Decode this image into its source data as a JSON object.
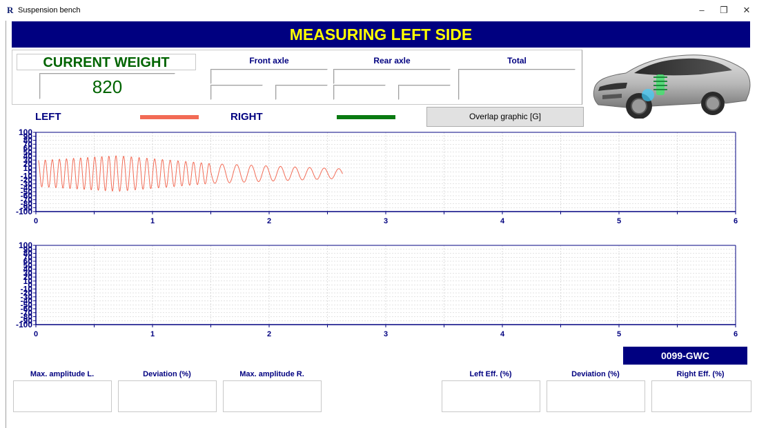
{
  "window": {
    "app_icon": "R",
    "title": "Suspension bench",
    "minimize": "–",
    "restore": "❐",
    "close": "✕"
  },
  "banner": {
    "title": "MEASURING LEFT SIDE"
  },
  "weight": {
    "label": "CURRENT WEIGHT",
    "value": "820",
    "front_axle": "Front axle",
    "rear_axle": "Rear axle",
    "total": "Total"
  },
  "legend": {
    "left_label": "LEFT",
    "right_label": "RIGHT",
    "left_color": "#f26b55",
    "right_color": "#0a7a12",
    "overlap_button": "Overlap graphic [G]"
  },
  "chart_data": [
    {
      "type": "line",
      "x_ticks": [
        "0",
        "1",
        "2",
        "3",
        "4",
        "5",
        "6"
      ],
      "y_ticks": [
        "100",
        "90",
        "80",
        "70",
        "60",
        "50",
        "40",
        "30",
        "20",
        "10",
        "0",
        "-10",
        "-20",
        "-30",
        "-40",
        "-50",
        "-60",
        "-70",
        "-80",
        "-90",
        "-100"
      ],
      "xlim": [
        0,
        6
      ],
      "ylim": [
        -100,
        100
      ],
      "grid": true,
      "series": [
        {
          "color": "#f26b55",
          "x_end": 2.63,
          "oscillation": [
            {
              "x_start": 0.02,
              "x_end": 0.7,
              "freq": 16.5,
              "amp_start": 33,
              "amp_end": 45
            },
            {
              "x_start": 0.7,
              "x_end": 1.5,
              "freq": 15.0,
              "amp_start": 45,
              "amp_end": 25
            },
            {
              "x_start": 1.5,
              "x_end": 2.63,
              "freq": 8.0,
              "amp_start": 25,
              "amp_end": 12
            }
          ]
        }
      ]
    },
    {
      "type": "line",
      "x_ticks": [
        "0",
        "1",
        "2",
        "3",
        "4",
        "5",
        "6"
      ],
      "y_ticks": [
        "100",
        "90",
        "80",
        "70",
        "60",
        "50",
        "40",
        "30",
        "20",
        "10",
        "0",
        "-10",
        "-20",
        "-30",
        "-40",
        "-50",
        "-60",
        "-70",
        "-80",
        "-90",
        "-100"
      ],
      "xlim": [
        0,
        6
      ],
      "ylim": [
        -100,
        100
      ],
      "grid": true,
      "series": []
    }
  ],
  "plate": "0099-GWC",
  "results": {
    "max_amp_left": "Max. amplitude L.",
    "deviation_1": "Deviation (%)",
    "max_amp_right": "Max. amplitude R.",
    "left_eff": "Left Eff. (%)",
    "deviation_2": "Deviation (%)",
    "right_eff": "Right Eff. (%)"
  }
}
